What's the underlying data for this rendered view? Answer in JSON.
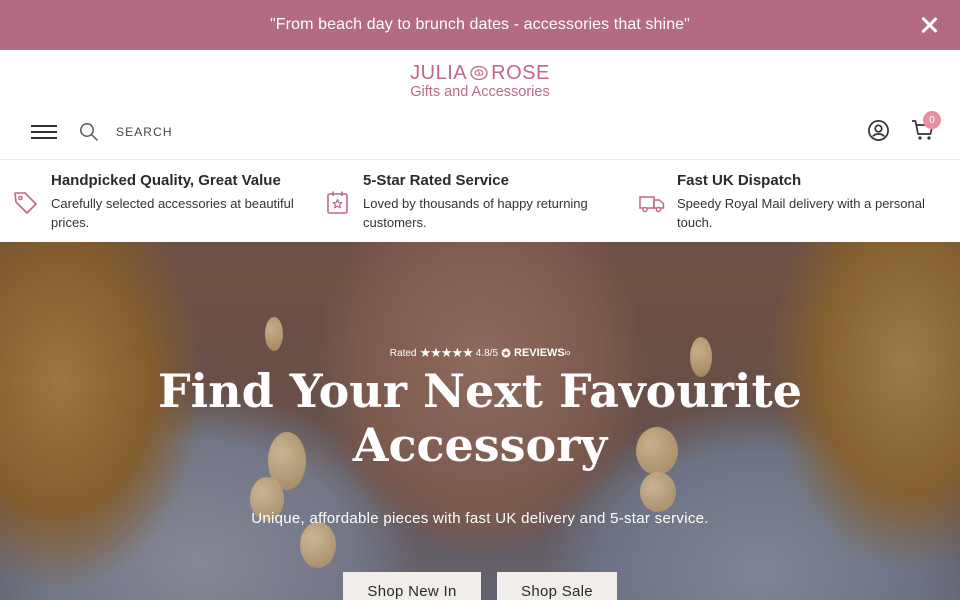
{
  "announcement": {
    "text": "\"From beach day to brunch dates - accessories that shine\"",
    "close_icon": "close-icon"
  },
  "header": {
    "logo_brand_left": "JULIA",
    "logo_brand_right": "ROSE",
    "logo_tagline": "Gifts and Accessories",
    "search_placeholder": "SEARCH",
    "cart_count": "0",
    "icons": [
      "menu-icon",
      "search-icon",
      "account-icon",
      "cart-icon"
    ]
  },
  "features": [
    {
      "icon": "tag-icon",
      "title": "Handpicked Quality, Great Value",
      "description": "Carefully selected accessories at beautiful prices."
    },
    {
      "icon": "calendar-star-icon",
      "title": "5-Star Rated Service",
      "description": "Loved by thousands of happy returning customers."
    },
    {
      "icon": "delivery-truck-icon",
      "title": "Fast UK Dispatch",
      "description": "Speedy Royal Mail delivery with a personal touch."
    }
  ],
  "hero": {
    "rating_prefix": "Rated",
    "rating_stars": "★★★★★",
    "rating_score": "4.8/5",
    "rating_brand": "REVIEWS",
    "rating_brand_suffix": "io",
    "title_line1": "Find Your Next Favourite",
    "title_line2": "Accessory",
    "subtitle": "Unique, affordable pieces with fast UK delivery and 5-star service.",
    "buttons": [
      "Shop New In",
      "Shop Sale"
    ]
  },
  "colors": {
    "announcement_bg": "#b36b84",
    "brand_pink": "#c0678a",
    "badge_pink": "#e88fa4",
    "button_bg": "#f2ecea"
  }
}
